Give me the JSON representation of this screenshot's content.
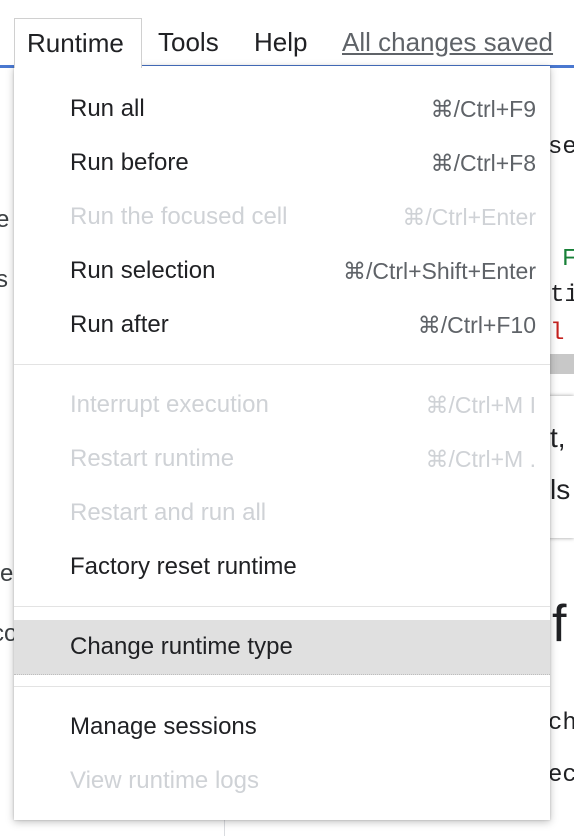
{
  "menubar": {
    "runtime": "Runtime",
    "tools": "Tools",
    "help": "Help",
    "saved_status": "All changes saved"
  },
  "background": {
    "left_fragments": [
      "e",
      "s",
      "re",
      "co"
    ],
    "right_fragments": {
      "line1": "se",
      "line2": "F",
      "line3": "ti",
      "line4": "l",
      "text1": "t,",
      "text2": "ls",
      "heading": "f",
      "code1": "ch",
      "code2": "ec"
    }
  },
  "menu": {
    "items": [
      {
        "label": "Run all",
        "shortcut": "⌘/Ctrl+F9",
        "enabled": true
      },
      {
        "label": "Run before",
        "shortcut": "⌘/Ctrl+F8",
        "enabled": true
      },
      {
        "label": "Run the focused cell",
        "shortcut": "⌘/Ctrl+Enter",
        "enabled": false
      },
      {
        "label": "Run selection",
        "shortcut": "⌘/Ctrl+Shift+Enter",
        "enabled": true
      },
      {
        "label": "Run after",
        "shortcut": "⌘/Ctrl+F10",
        "enabled": true
      },
      {
        "label": "Interrupt execution",
        "shortcut": "⌘/Ctrl+M I",
        "enabled": false
      },
      {
        "label": "Restart runtime",
        "shortcut": "⌘/Ctrl+M .",
        "enabled": false
      },
      {
        "label": "Restart and run all",
        "shortcut": "",
        "enabled": false
      },
      {
        "label": "Factory reset runtime",
        "shortcut": "",
        "enabled": true
      },
      {
        "label": "Change runtime type",
        "shortcut": "",
        "enabled": true,
        "highlighted": true
      },
      {
        "label": "Manage sessions",
        "shortcut": "",
        "enabled": true
      },
      {
        "label": "View runtime logs",
        "shortcut": "",
        "enabled": false
      }
    ]
  },
  "colors": {
    "accent_line": "#4a78d0",
    "highlight": "#e0e0e0",
    "code_green": "#188038",
    "code_red": "#c5221f"
  }
}
